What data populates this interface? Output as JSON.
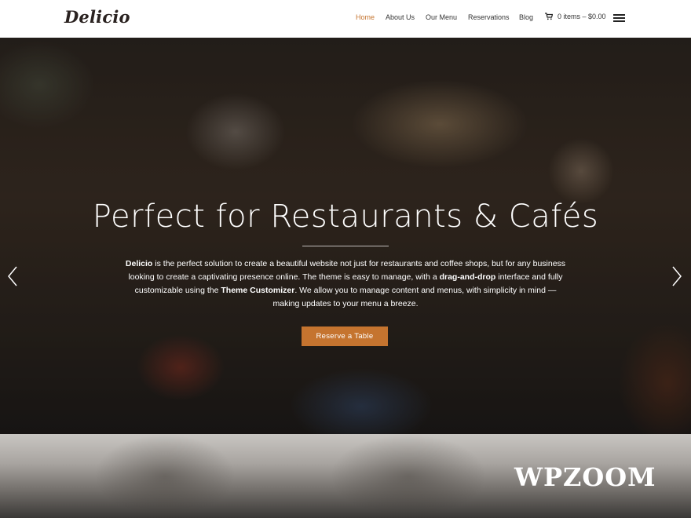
{
  "header": {
    "logo": "Delicio",
    "nav": [
      {
        "label": "Home",
        "active": true
      },
      {
        "label": "About Us",
        "active": false
      },
      {
        "label": "Our Menu",
        "active": false
      },
      {
        "label": "Reservations",
        "active": false
      },
      {
        "label": "Blog",
        "active": false
      }
    ],
    "cart_label": "0 items – $0.00",
    "accent_color": "#c5742f"
  },
  "hero": {
    "title": "Perfect for Restaurants & Cafés",
    "text_parts": {
      "p1_bold": "Delicio",
      "p1": " is the perfect solution to create a beautiful website not just for restaurants and coffee shops, but for any business looking to create a captivating presence online. The theme is easy to manage, with a ",
      "p2_bold": "drag-and-drop",
      "p2": " interface and fully customizable using the ",
      "p3_bold": "Theme Customizer",
      "p3": ". We allow you to manage content and menus, with simplicity in mind — making updates to your menu a breeze."
    },
    "button_label": "Reserve a Table",
    "prev_icon": "chevron-left-icon",
    "next_icon": "chevron-right-icon"
  },
  "watermark": "WPZOOM"
}
